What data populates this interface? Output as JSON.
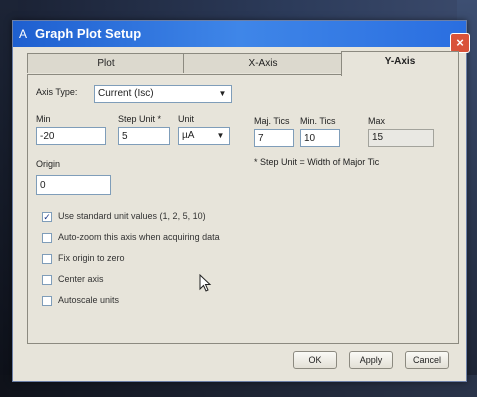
{
  "window": {
    "title": "Graph Plot Setup",
    "app_icon": "A",
    "close_glyph": "×"
  },
  "tabs": [
    {
      "label": "Plot"
    },
    {
      "label": "X-Axis"
    },
    {
      "label": "Y-Axis"
    }
  ],
  "axis_type": {
    "label": "Axis Type:",
    "value": "Current (Isc)"
  },
  "min": {
    "label": "Min",
    "value": "-20"
  },
  "step_unit": {
    "label": "Step Unit *",
    "value": "5"
  },
  "unit": {
    "label": "Unit",
    "value": "µA"
  },
  "maj_tics": {
    "label": "Maj. Tics",
    "value": "7"
  },
  "min_tics": {
    "label": "Min. Tics",
    "value": "10"
  },
  "max": {
    "label": "Max",
    "value": "15"
  },
  "origin": {
    "label": "Origin",
    "value": "0"
  },
  "note": "* Step Unit = Width of Major Tic",
  "options": [
    {
      "label": "Use standard unit values (1, 2, 5, 10)",
      "checked": true
    },
    {
      "label": "Auto-zoom this axis when acquiring data",
      "checked": false
    },
    {
      "label": "Fix origin to zero",
      "checked": false
    },
    {
      "label": "Center axis",
      "checked": false
    },
    {
      "label": "Autoscale units",
      "checked": false
    }
  ],
  "buttons": {
    "ok": "OK",
    "apply": "Apply",
    "cancel": "Cancel"
  },
  "check_glyph": "✓"
}
